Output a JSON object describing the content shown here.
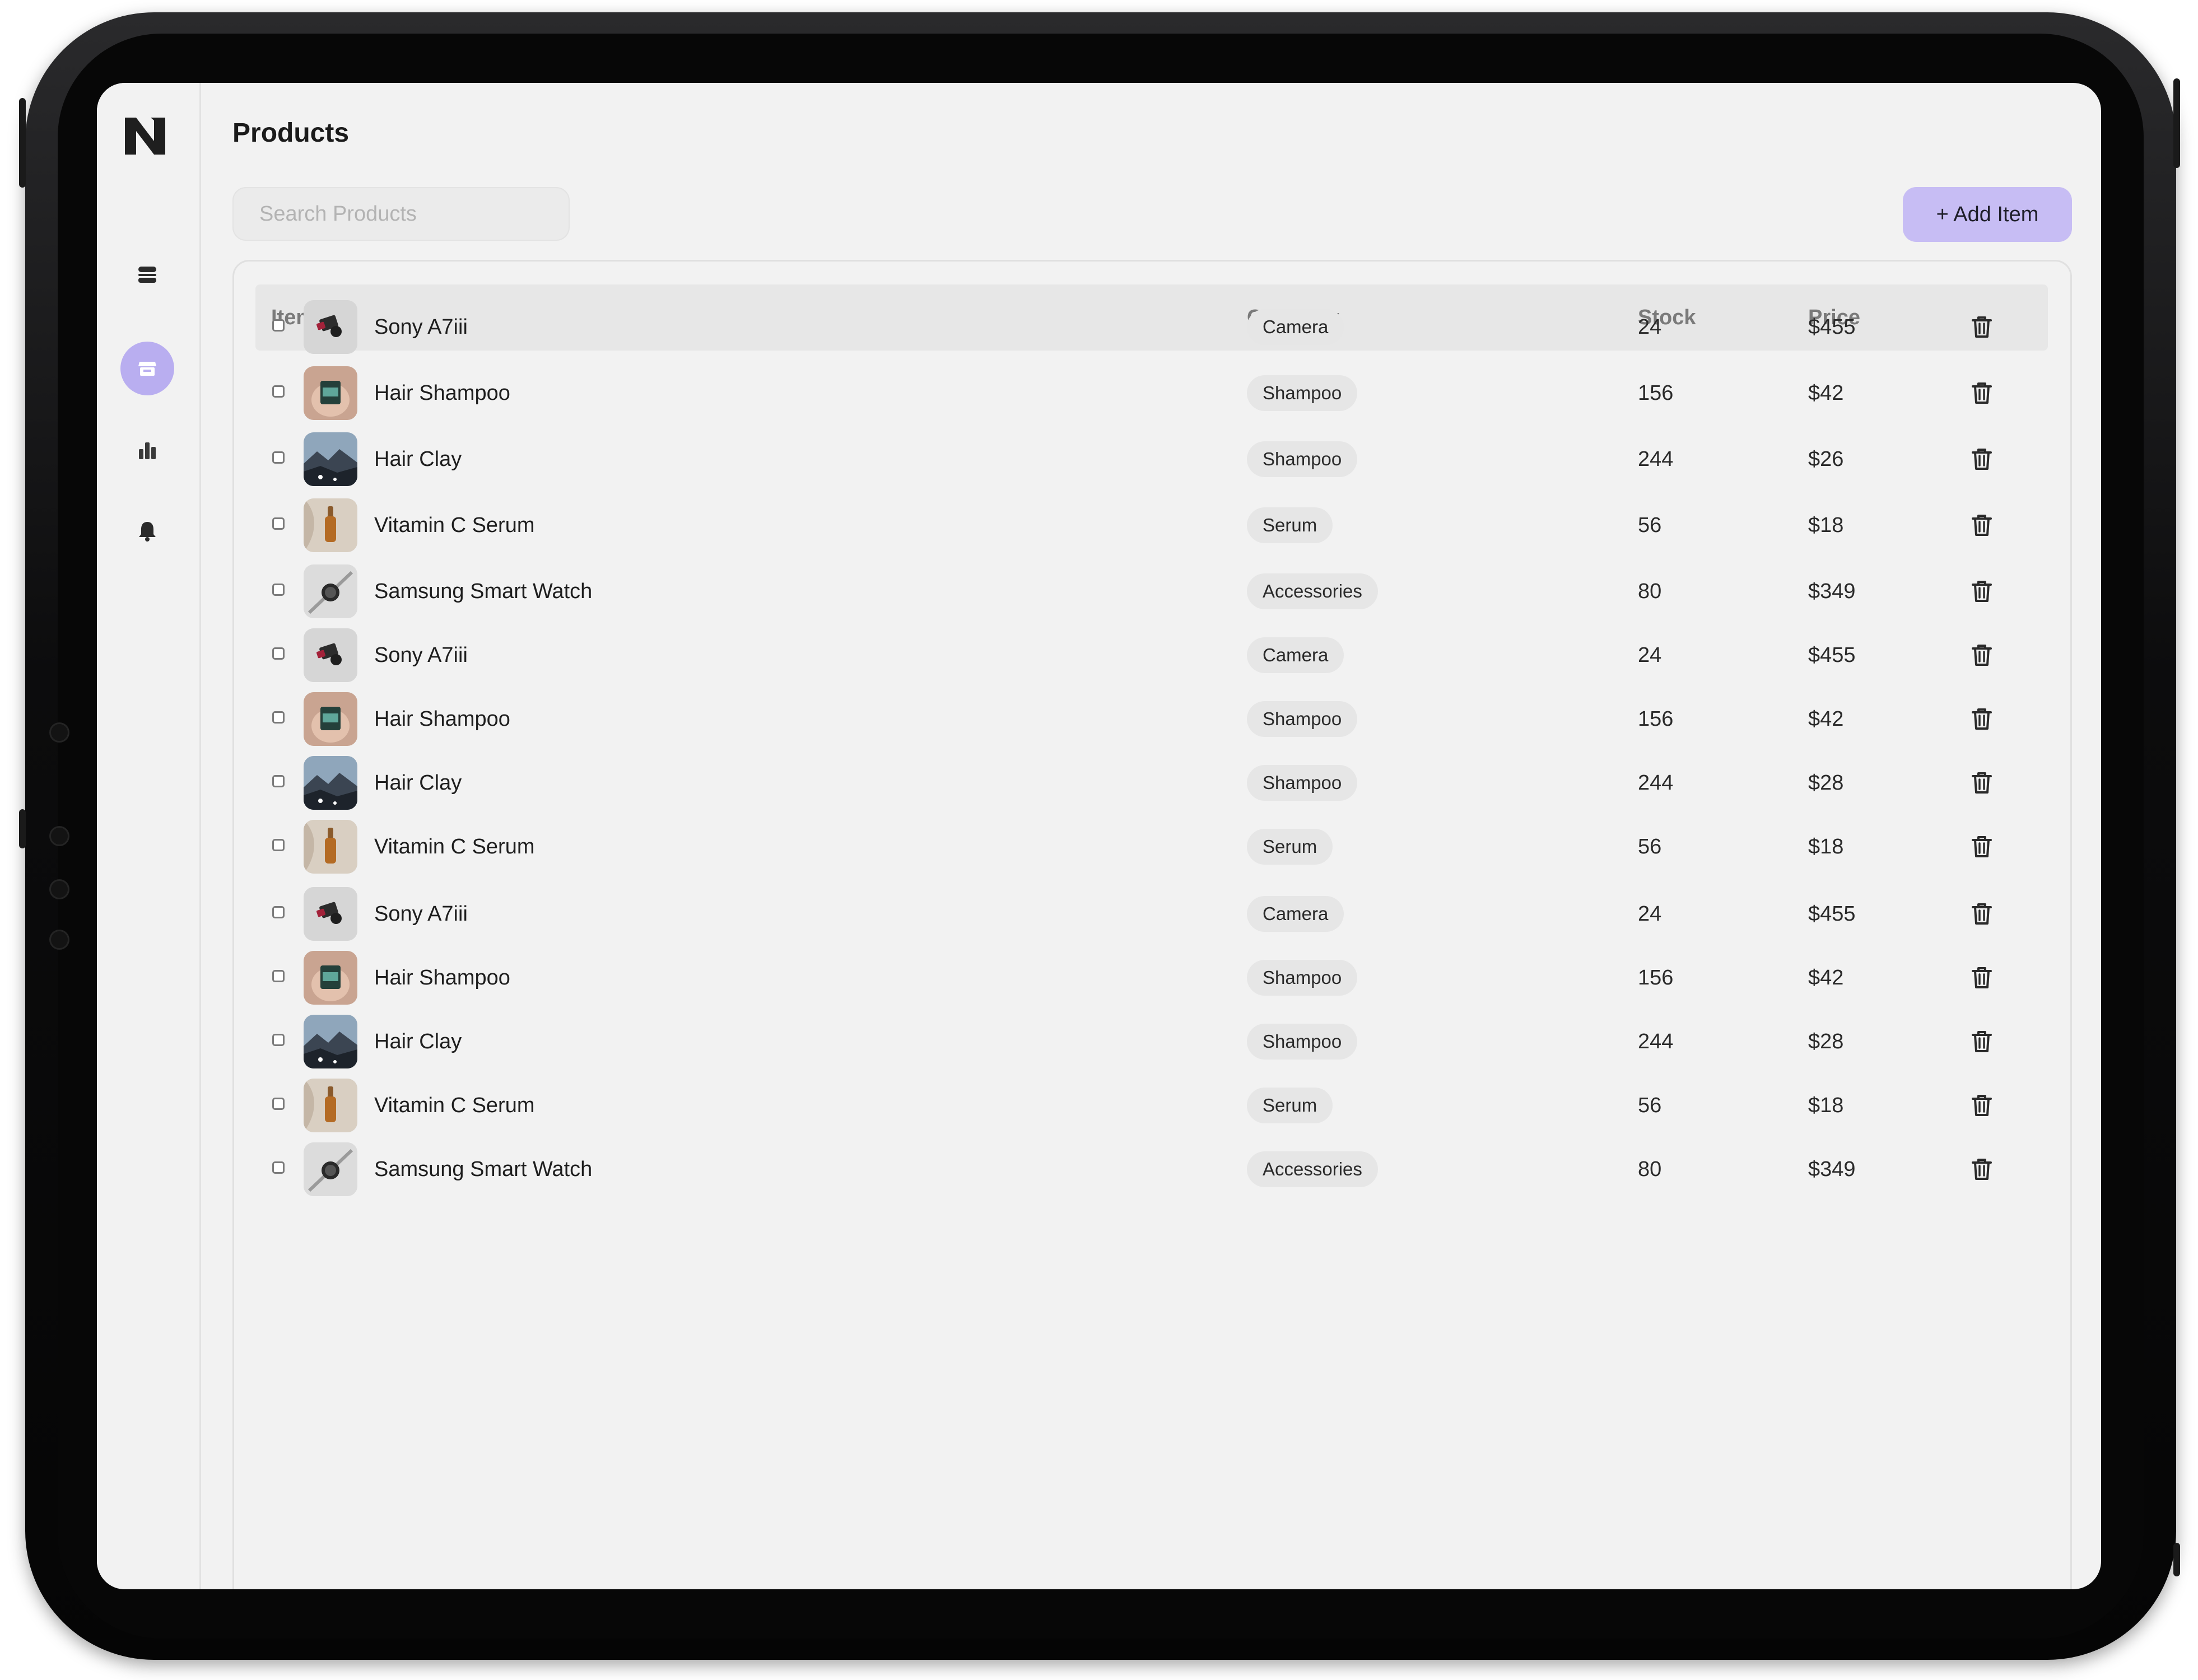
{
  "app": {
    "page_title": "Products"
  },
  "sidebar": {
    "items": [
      {
        "name": "menu-icon"
      },
      {
        "name": "store-icon",
        "active": true
      },
      {
        "name": "bar-chart-icon"
      },
      {
        "name": "bell-icon"
      }
    ]
  },
  "search": {
    "placeholder": "Search Products",
    "value": ""
  },
  "toolbar": {
    "add_label": "+ Add Item"
  },
  "table": {
    "headers": {
      "item": "Item",
      "category": "Category",
      "stock": "Stock",
      "price": "Price"
    },
    "rows": [
      {
        "name": "Sony A7iii",
        "category": "Camera",
        "stock": "24",
        "price": "$455",
        "thumb": "camera"
      },
      {
        "name": "Hair Shampoo",
        "category": "Shampoo",
        "stock": "156",
        "price": "$42",
        "thumb": "shampoo"
      },
      {
        "name": "Hair Clay",
        "category": "Shampoo",
        "stock": "244",
        "price": "$26",
        "thumb": "clay"
      },
      {
        "name": "Vitamin C Serum",
        "category": "Serum",
        "stock": "56",
        "price": "$18",
        "thumb": "serum"
      },
      {
        "name": "Samsung Smart Watch",
        "category": "Accessories",
        "stock": "80",
        "price": "$349",
        "thumb": "watch"
      },
      {
        "name": "Sony A7iii",
        "category": "Camera",
        "stock": "24",
        "price": "$455",
        "thumb": "camera"
      },
      {
        "name": "Hair Shampoo",
        "category": "Shampoo",
        "stock": "156",
        "price": "$42",
        "thumb": "shampoo"
      },
      {
        "name": "Hair Clay",
        "category": "Shampoo",
        "stock": "244",
        "price": "$28",
        "thumb": "clay"
      },
      {
        "name": "Vitamin C Serum",
        "category": "Serum",
        "stock": "56",
        "price": "$18",
        "thumb": "serum"
      },
      {
        "name": "Sony A7iii",
        "category": "Camera",
        "stock": "24",
        "price": "$455",
        "thumb": "camera"
      },
      {
        "name": "Hair Shampoo",
        "category": "Shampoo",
        "stock": "156",
        "price": "$42",
        "thumb": "shampoo"
      },
      {
        "name": "Hair Clay",
        "category": "Shampoo",
        "stock": "244",
        "price": "$28",
        "thumb": "clay"
      },
      {
        "name": "Vitamin C Serum",
        "category": "Serum",
        "stock": "56",
        "price": "$18",
        "thumb": "serum"
      },
      {
        "name": "Samsung Smart Watch",
        "category": "Accessories",
        "stock": "80",
        "price": "$349",
        "thumb": "watch"
      }
    ]
  },
  "colors": {
    "accent": "#c7bdf4",
    "active_nav": "#b9aef0",
    "background": "#f2f2f2"
  }
}
